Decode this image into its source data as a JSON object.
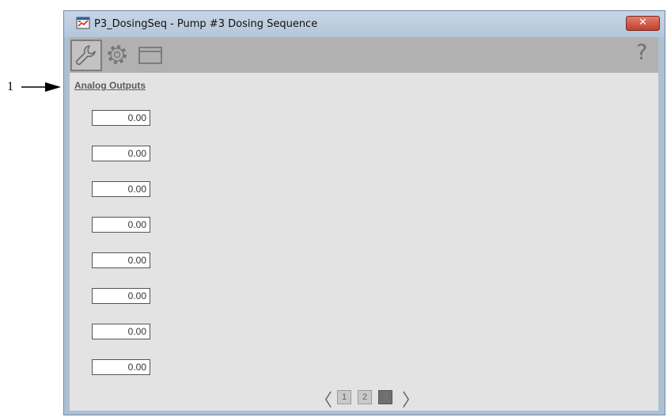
{
  "callout": {
    "label": "1"
  },
  "window": {
    "title": "P3_DosingSeq - Pump #3 Dosing Sequence",
    "close_label": "✕"
  },
  "toolbar": {
    "buttons": [
      {
        "icon": "wrench-icon",
        "active": true
      },
      {
        "icon": "gear-icon",
        "active": false
      },
      {
        "icon": "window-icon",
        "active": false
      }
    ],
    "help_label": "?"
  },
  "section": {
    "title": "Analog Outputs"
  },
  "outputs": [
    "0.00",
    "0.00",
    "0.00",
    "0.00",
    "0.00",
    "0.00",
    "0.00",
    "0.00"
  ],
  "pager": {
    "prev": "〈",
    "next": "〉",
    "pages": [
      "1",
      "2",
      "3"
    ],
    "current_page": "3"
  },
  "colors": {
    "titlebar": "#b4c6da",
    "toolbar": "#b1b1b1",
    "client": "#e3e3e3",
    "close_button": "#c1402c",
    "section_title": "#5c5c5c"
  }
}
